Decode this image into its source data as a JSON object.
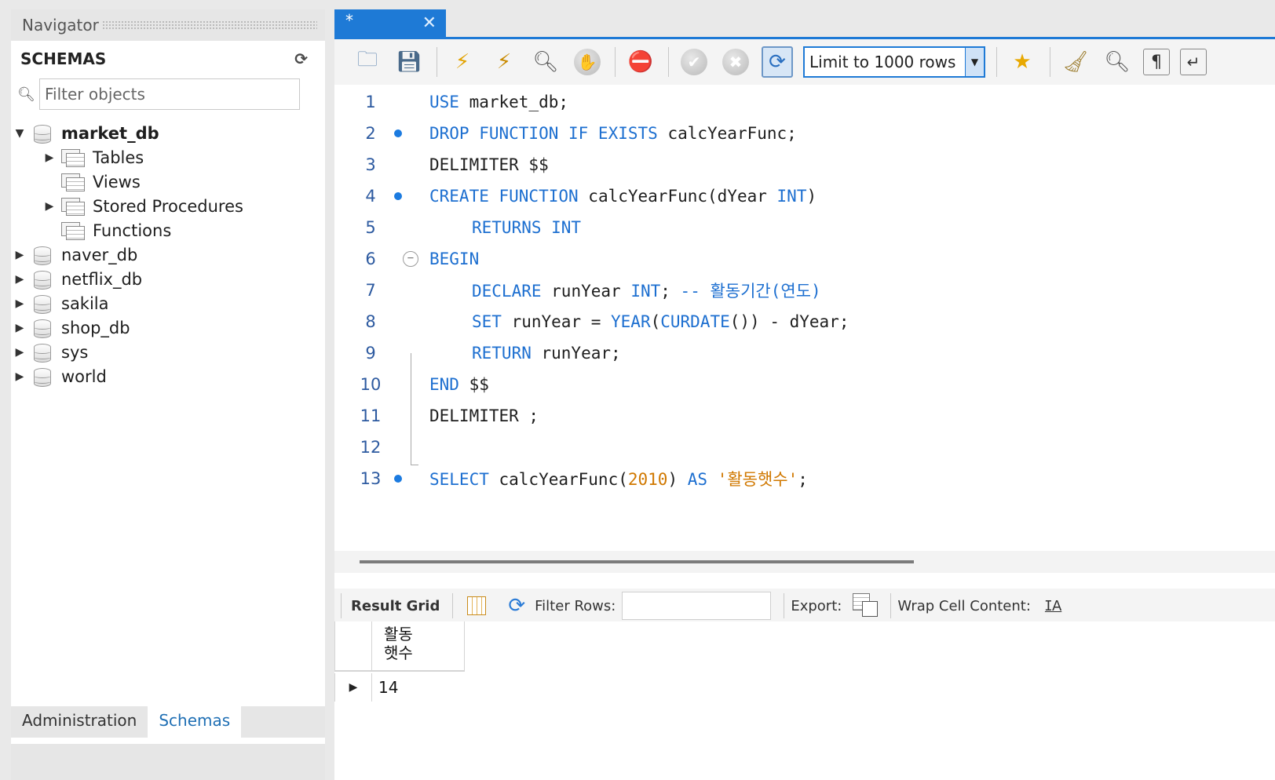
{
  "navigator": {
    "title": "Navigator",
    "schemas_label": "SCHEMAS",
    "filter_placeholder": "Filter objects",
    "databases": [
      {
        "name": "market_db",
        "expanded": true,
        "children": [
          "Tables",
          "Views",
          "Stored Procedures",
          "Functions"
        ]
      },
      {
        "name": "naver_db"
      },
      {
        "name": "netflix_db"
      },
      {
        "name": "sakila"
      },
      {
        "name": "shop_db"
      },
      {
        "name": "sys"
      },
      {
        "name": "world"
      }
    ],
    "tabs": [
      "Administration",
      "Schemas"
    ],
    "active_tab": "Schemas"
  },
  "editor": {
    "tab_title": "*",
    "limit_select": "Limit to 1000 rows",
    "lines": [
      {
        "n": "1"
      },
      {
        "n": "2"
      },
      {
        "n": "3"
      },
      {
        "n": "4"
      },
      {
        "n": "5"
      },
      {
        "n": "6"
      },
      {
        "n": "7"
      },
      {
        "n": "8"
      },
      {
        "n": "9"
      },
      {
        "n": "10"
      },
      {
        "n": "11"
      },
      {
        "n": "12"
      },
      {
        "n": "13"
      }
    ],
    "code": {
      "l1": {
        "kw": "USE",
        "rest": " market_db;"
      },
      "l2": {
        "kw": "DROP FUNCTION IF EXISTS",
        "rest": " calcYearFunc;"
      },
      "l3": {
        "text": "DELIMITER $$"
      },
      "l4": {
        "kw": "CREATE FUNCTION",
        "rest": " calcYearFunc(dYear ",
        "kw2": "INT",
        "rest2": ")"
      },
      "l5": {
        "kw": "RETURNS INT"
      },
      "l6": {
        "kw": "BEGIN"
      },
      "l7": {
        "kw": "DECLARE",
        "rest": " runYear ",
        "kw2": "INT",
        "rest2": "; ",
        "comment": "-- 활동기간(연도)"
      },
      "l8": {
        "kw": "SET",
        "rest": " runYear = ",
        "fn": "YEAR",
        "p1": "(",
        "fn2": "CURDATE",
        "rest2": "()) - dYear;"
      },
      "l9": {
        "kw": "RETURN",
        "rest": " runYear;"
      },
      "l10": {
        "kw": "END",
        "rest": " $$"
      },
      "l11": {
        "text": "DELIMITER ;"
      },
      "l13": {
        "kw": "SELECT",
        "rest": " calcYearFunc(",
        "num": "2010",
        "rest2": ") ",
        "kw2": "AS",
        "sp": " ",
        "str": "'활동햇수'",
        "rest3": ";"
      }
    }
  },
  "results": {
    "result_grid_label": "Result Grid",
    "filter_rows_label": "Filter Rows:",
    "export_label": "Export:",
    "wrap_label": "Wrap Cell Content:",
    "columns": [
      "활동\n햇수"
    ],
    "rows": [
      [
        "14"
      ]
    ]
  },
  "colors": {
    "accent": "#1e7ad6",
    "keyword": "#1d6fd0",
    "literal": "#d07800"
  }
}
